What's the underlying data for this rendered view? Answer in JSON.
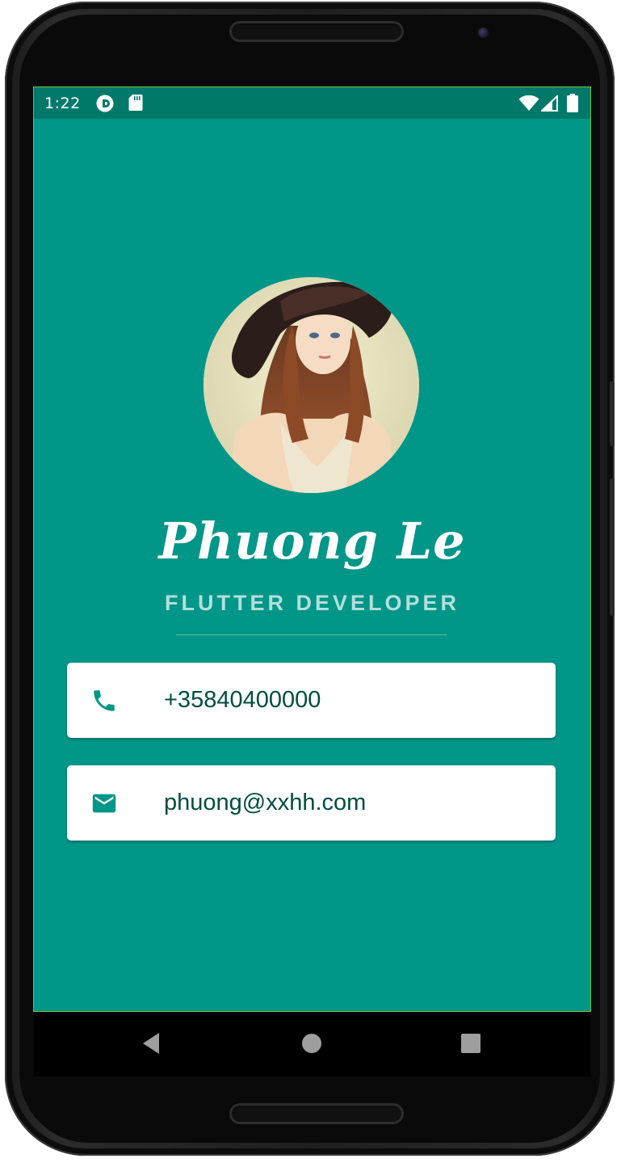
{
  "status_bar": {
    "time": "1:22",
    "left_icons": [
      "app-notification-icon",
      "sd-card-icon"
    ],
    "right_icons": [
      "wifi-icon",
      "cell-signal-icon",
      "battery-icon"
    ]
  },
  "profile": {
    "avatar": "profile-avatar-illustration",
    "name": "Phuong Le",
    "title": "FLUTTER DEVELOPER"
  },
  "contacts": [
    {
      "icon": "phone-icon",
      "value": "+35840400000"
    },
    {
      "icon": "email-icon",
      "value": "phuong@xxhh.com"
    }
  ],
  "nav_bar": {
    "buttons": [
      "back-icon",
      "home-icon",
      "recents-icon"
    ]
  },
  "colors": {
    "background": "#009688",
    "status_bar": "#00796b",
    "title_text": "#b2dfdb",
    "card_text": "#004d40",
    "icon": "#009688"
  }
}
